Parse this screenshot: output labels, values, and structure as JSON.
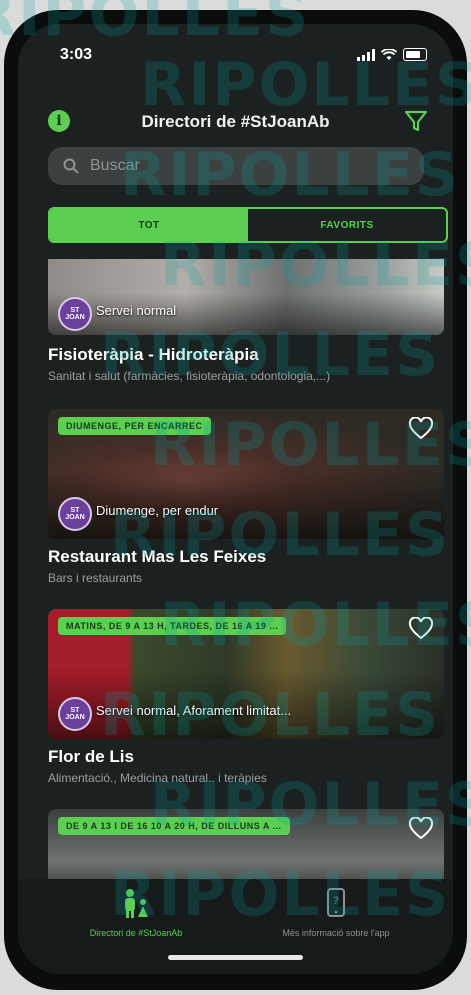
{
  "status": {
    "time": "3:03"
  },
  "header": {
    "title": "Directori de #StJoanAb"
  },
  "search": {
    "placeholder": "Buscar"
  },
  "tabs": [
    {
      "label": "TOT",
      "active": true
    },
    {
      "label": "FAVORITS",
      "active": false
    }
  ],
  "cards": [
    {
      "service": "Servei normal",
      "title": "Fisioteràpia - Hidroteràpia",
      "category": "Sanitat i salut (farmàcies, fisioteràpia, odontologia,...)"
    },
    {
      "badge": "DIUMENGE, PER ENCARREC",
      "service": "Diumenge, per endur",
      "title": "Restaurant Mas Les Feixes",
      "category": "Bars i restaurants"
    },
    {
      "badge": "MATINS, DE 9 A 13 H, TARDES, DE 16 A 19 ...",
      "service": "Servei normal, Aforament limitat...",
      "title": "Flor de Lis",
      "category": "Alimentació., Medicina natural.. i teràpies"
    },
    {
      "badge": "DE 9 A 13 I DE 16 10 A 20 H, DE DILLUNS A ..."
    }
  ],
  "tabbar": {
    "directory_label": "Directori de #StJoanAb",
    "info_label": "Més informació sobre l'app"
  },
  "watermark": "RIPOLLES",
  "colors": {
    "accent": "#5ccf52",
    "background": "#1b2020"
  }
}
